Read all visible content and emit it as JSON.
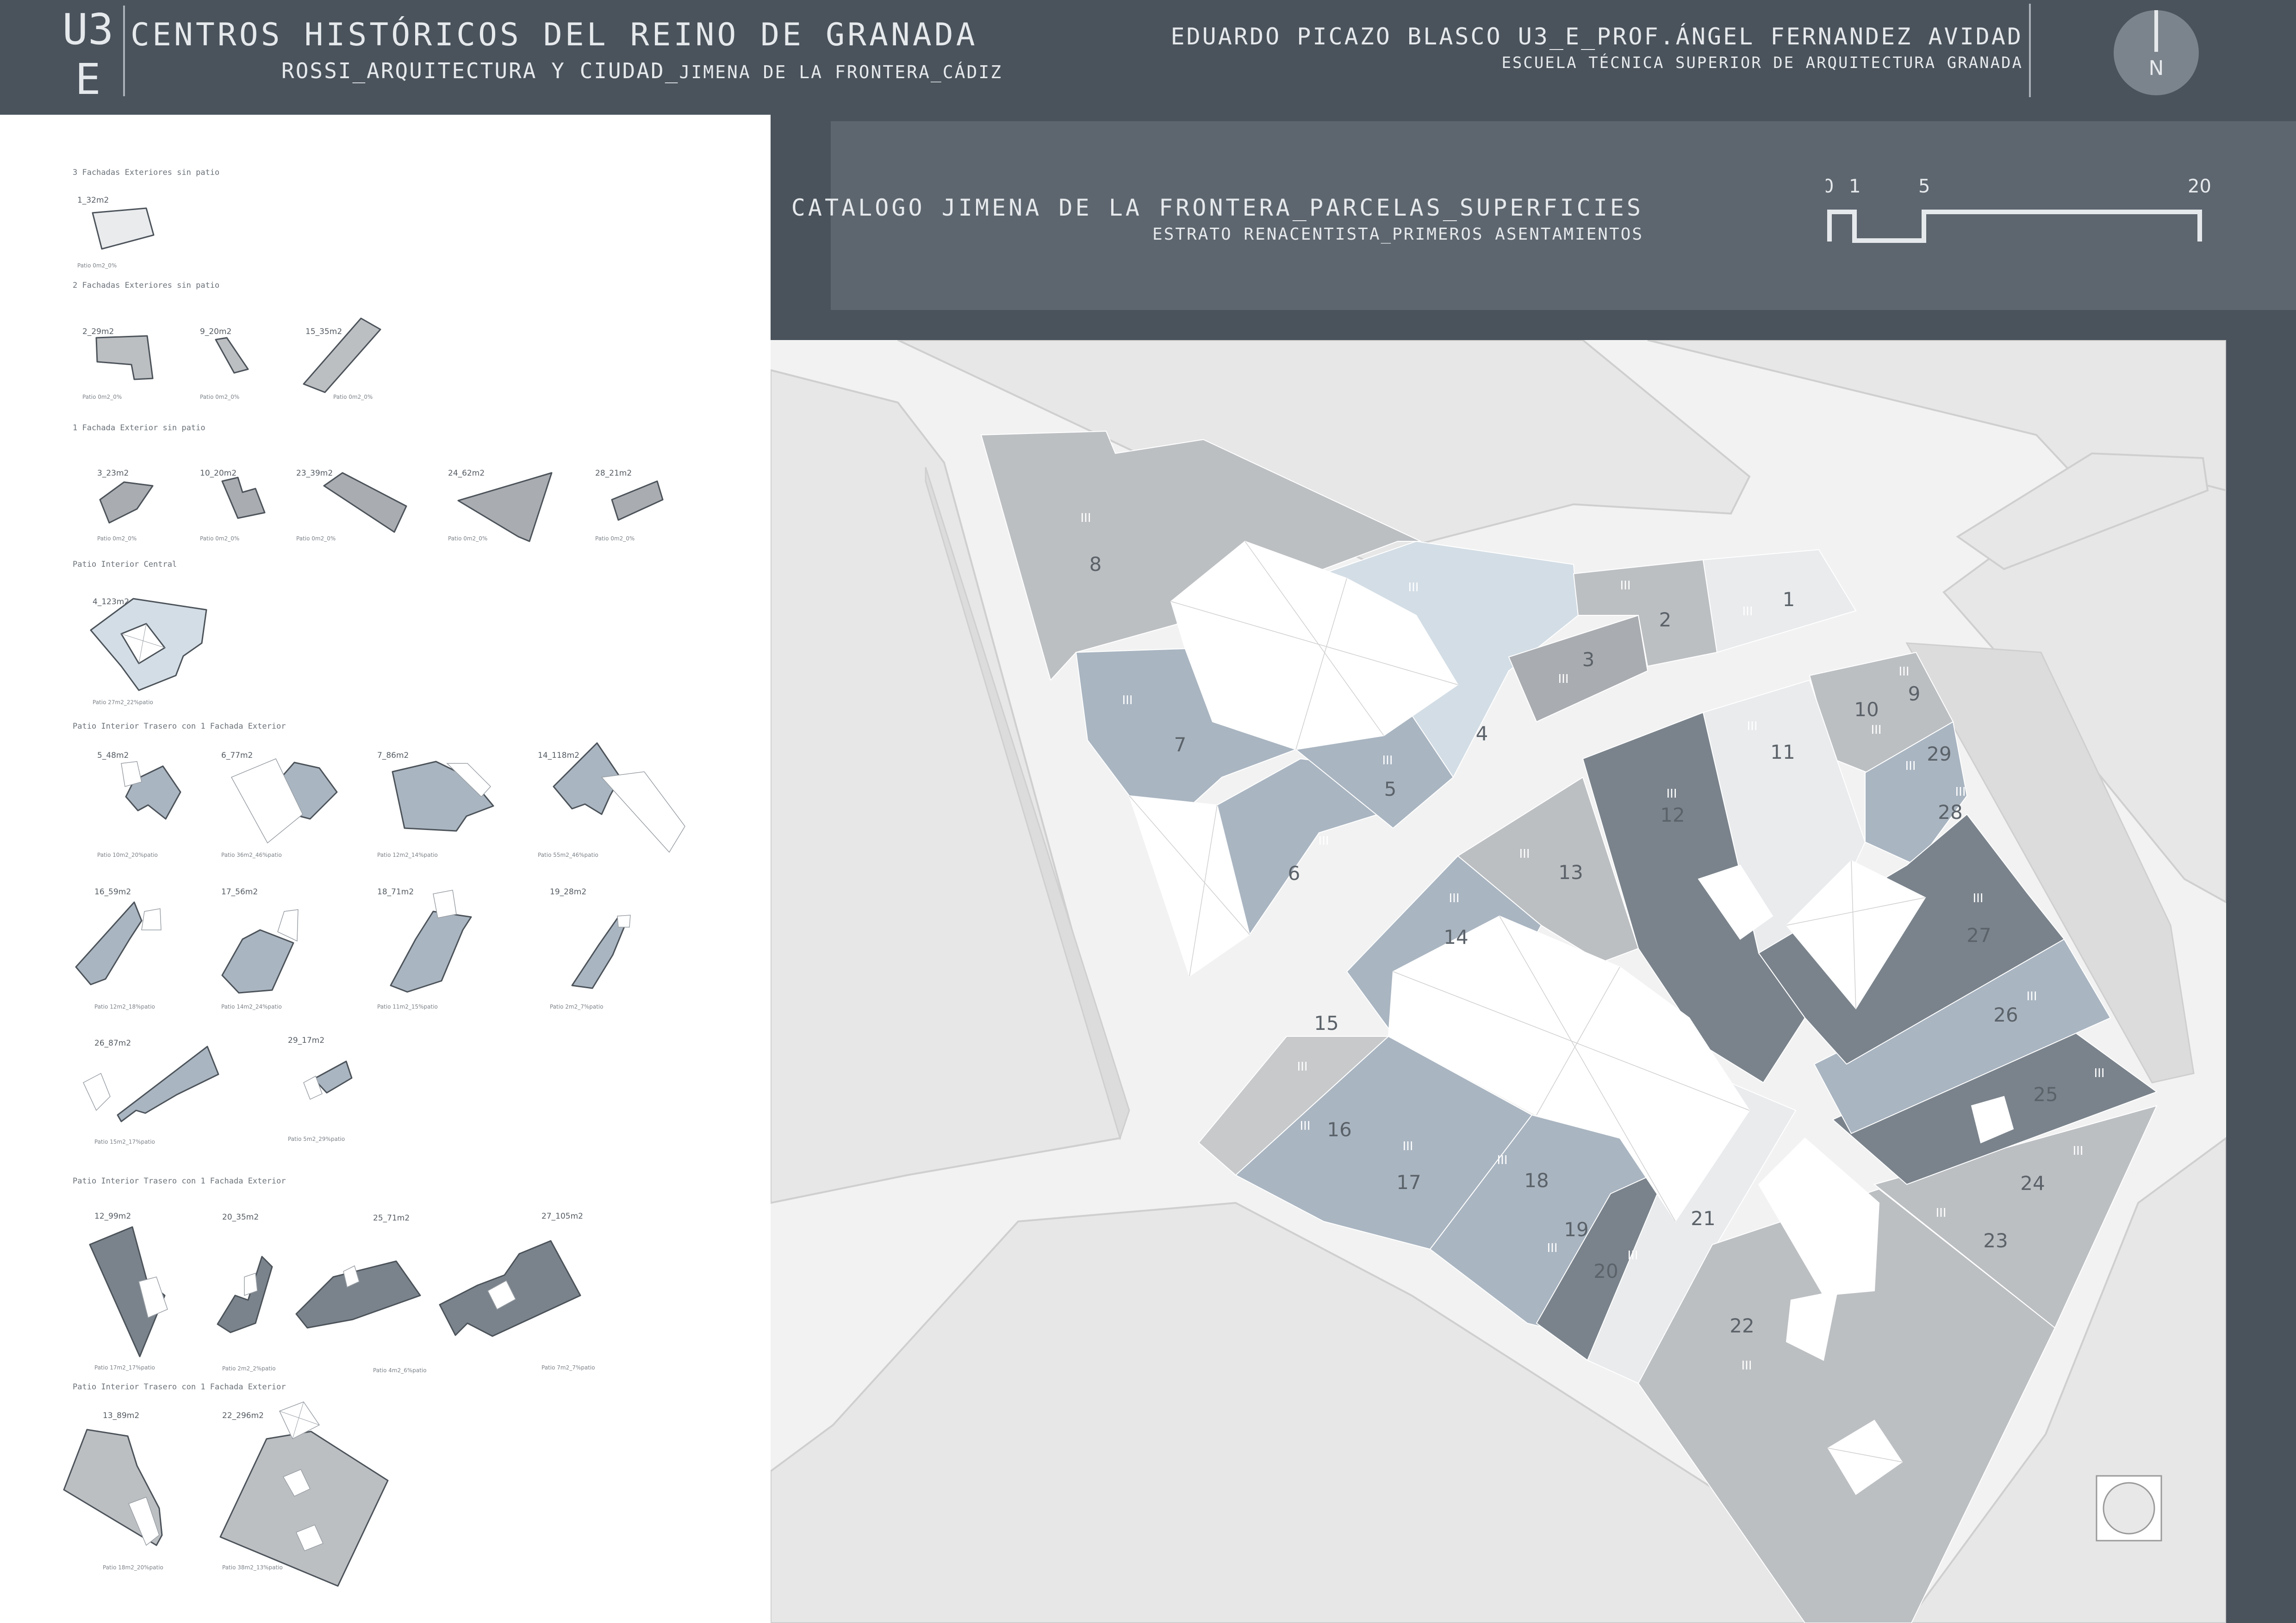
{
  "header": {
    "logo_line1": "U3",
    "logo_line2": "E",
    "title": "CENTROS HISTÓRICOS DEL REINO DE GRANADA",
    "subtitle_main": "ROSSI_ARQUITECTURA Y CIUDAD_",
    "subtitle_small": "JIMENA DE LA FRONTERA_CÁDIZ",
    "author": "EDUARDO PICAZO BLASCO U3_E_PROF.ÁNGEL FERNANDEZ AVIDAD",
    "school": "ESCUELA TÉCNICA SUPERIOR DE ARQUITECTURA GRANADA",
    "north": "N"
  },
  "catalog": {
    "title": "CATALOGO JIMENA DE LA FRONTERA_PARCELAS_SUPERFICIES",
    "subtitle": "ESTRATO RENACENTISTA_PRIMEROS ASENTAMIENTOS",
    "scale_labels": [
      "0",
      "1",
      "5",
      "20"
    ]
  },
  "groups": [
    {
      "heading": "3 Fachadas Exteriores sin patio",
      "plots": [
        {
          "label": "1_32m2",
          "patio": "Patio 0m2_0%"
        }
      ]
    },
    {
      "heading": "2 Fachadas Exteriores sin patio",
      "plots": [
        {
          "label": "2_29m2",
          "patio": "Patio 0m2_0%"
        },
        {
          "label": "9_20m2",
          "patio": "Patio 0m2_0%"
        },
        {
          "label": "15_35m2",
          "patio": "Patio 0m2_0%"
        }
      ]
    },
    {
      "heading": "1 Fachada Exterior sin patio",
      "plots": [
        {
          "label": "3_23m2",
          "patio": "Patio 0m2_0%"
        },
        {
          "label": "10_20m2",
          "patio": "Patio 0m2_0%"
        },
        {
          "label": "23_39m2",
          "patio": "Patio 0m2_0%"
        },
        {
          "label": "24_62m2",
          "patio": "Patio 0m2_0%"
        },
        {
          "label": "28_21m2",
          "patio": "Patio 0m2_0%"
        }
      ]
    },
    {
      "heading": "Patio Interior Central",
      "plots": [
        {
          "label": "4_123m2",
          "patio": "Patio 27m2_22%patio"
        }
      ]
    },
    {
      "heading": "Patio Interior Trasero con 1 Fachada Exterior",
      "plots": [
        {
          "label": "5_48m2",
          "patio": "Patio 10m2_20%patio"
        },
        {
          "label": "6_77m2",
          "patio": "Patio 36m2_46%patio"
        },
        {
          "label": "7_86m2",
          "patio": "Patio 12m2_14%patio"
        },
        {
          "label": "14_118m2",
          "patio": "Patio 55m2_46%patio"
        },
        {
          "label": "16_59m2",
          "patio": "Patio 12m2_18%patio"
        },
        {
          "label": "17_56m2",
          "patio": "Patio 14m2_24%patio"
        },
        {
          "label": "18_71m2",
          "patio": "Patio 11m2_15%patio"
        },
        {
          "label": "19_28m2",
          "patio": "Patio 2m2_7%patio"
        },
        {
          "label": "26_87m2",
          "patio": "Patio 15m2_17%patio"
        },
        {
          "label": "29_17m2",
          "patio": "Patio 5m2_29%patio"
        }
      ]
    },
    {
      "heading": "Patio Interior Trasero con 1 Fachada Exterior",
      "plots": [
        {
          "label": "12_99m2",
          "patio": "Patio 17m2_17%patio"
        },
        {
          "label": "20_35m2",
          "patio": "Patio 2m2_2%patio"
        },
        {
          "label": "25_71m2",
          "patio": "Patio 4m2_6%patio"
        },
        {
          "label": "27_105m2",
          "patio": "Patio 7m2_7%patio"
        }
      ]
    },
    {
      "heading": "Patio Interior Trasero con 1 Fachada Exterior",
      "plots": [
        {
          "label": "13_89m2",
          "patio": "Patio 18m2_20%patio"
        },
        {
          "label": "22_296m2",
          "patio": "Patio 38m2_13%patio"
        }
      ]
    }
  ],
  "map": {
    "storeys": "III",
    "parcels": [
      "1",
      "2",
      "3",
      "4",
      "5",
      "6",
      "7",
      "8",
      "9",
      "10",
      "11",
      "12",
      "13",
      "14",
      "15",
      "16",
      "17",
      "18",
      "19",
      "20",
      "21",
      "22",
      "23",
      "24",
      "25",
      "26",
      "27",
      "28",
      "29"
    ]
  },
  "colors": {
    "background": "#4a535c",
    "panel": "#5d666f",
    "text": "#e6e9ec",
    "parcel_light": "#e9ebed",
    "parcel_blue": "#a9b5c1",
    "parcel_pale_blue": "#d3dde5",
    "parcel_grey": "#bcbfc2",
    "parcel_dark": "#7a838c",
    "street": "#e6e6e6"
  }
}
